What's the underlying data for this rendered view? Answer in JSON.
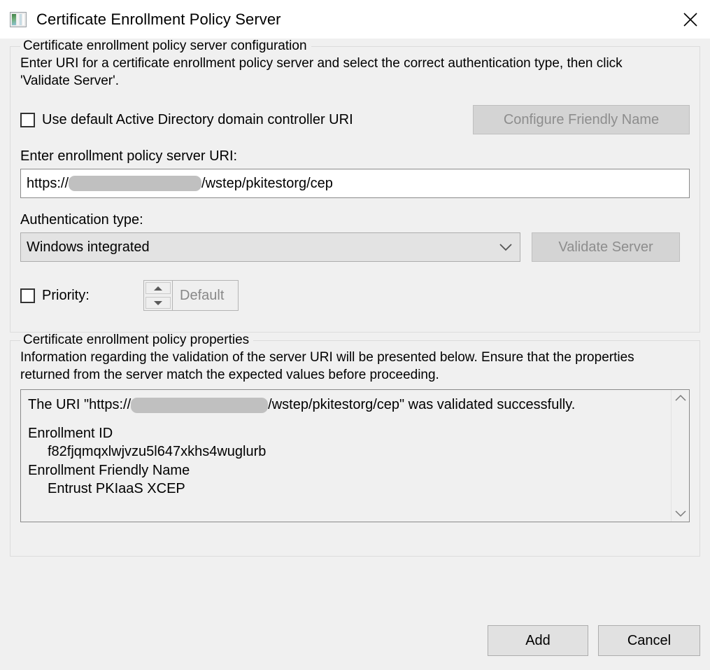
{
  "window": {
    "title": "Certificate Enrollment Policy Server",
    "icon": "certificate-window-icon",
    "close_icon": "close-icon"
  },
  "config_group": {
    "legend": "Certificate enrollment policy server configuration",
    "description": "Enter URI for a certificate enrollment policy server and select the correct authentication type, then click 'Validate Server'.",
    "use_default_checkbox": {
      "label": "Use default Active Directory domain controller URI",
      "checked": false
    },
    "configure_friendly_name_button": {
      "label": "Configure Friendly Name",
      "enabled": false
    },
    "uri_label": "Enter enrollment policy server URI:",
    "uri_value_prefix": "https://",
    "uri_value_suffix": "/wstep/pkitestorg/cep",
    "uri_redacted": true,
    "auth_label": "Authentication type:",
    "auth_value": "Windows integrated",
    "auth_chevron": "chevron-down-icon",
    "validate_server_button": {
      "label": "Validate Server",
      "enabled": false
    },
    "priority_checkbox": {
      "label": "Priority:",
      "checked": false
    },
    "priority_value": "Default",
    "priority_spinner_up": "spinner-up-icon",
    "priority_spinner_down": "spinner-down-icon"
  },
  "properties_group": {
    "legend": "Certificate enrollment policy properties",
    "description": "Information regarding the validation of the server URI will be presented below. Ensure that the properties returned from the server match the expected values before proceeding.",
    "log": {
      "line1_prefix": "The URI \"https://",
      "line1_suffix": "/wstep/pkitestorg/cep\" was validated successfully.",
      "enrollment_id_label": "Enrollment ID",
      "enrollment_id_value": "f82fjqmqxlwjvzu5l647xkhs4wuglurb",
      "friendly_name_label": "Enrollment Friendly Name",
      "friendly_name_value": "Entrust PKIaaS XCEP"
    },
    "scrollbar": {
      "up_icon": "scroll-up-icon",
      "down_icon": "scroll-down-icon"
    }
  },
  "footer": {
    "add_label": "Add",
    "cancel_label": "Cancel"
  },
  "colors": {
    "dialog_bg": "#f0f0f0",
    "titlebar_bg": "#ffffff",
    "button_face": "#e1e1e1",
    "button_disabled": "#d4d4d4",
    "disabled_text": "#8d8d8d",
    "field_border": "#8a8a8a",
    "redaction": "#c0c0c0"
  }
}
